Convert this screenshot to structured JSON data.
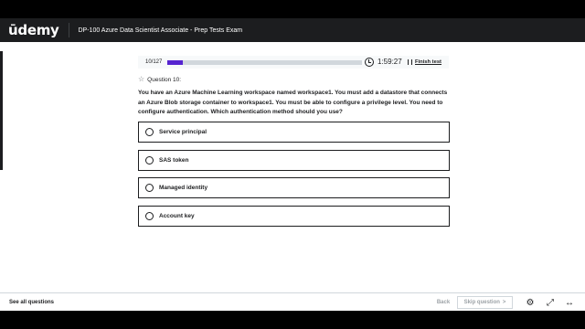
{
  "header": {
    "logo": "ūdemy",
    "course_title": "DP-100 Azure Data Scientist Associate - Prep Tests Exam"
  },
  "progress": {
    "counter": "10/127",
    "fraction": 0.0787,
    "timer": "1:59:27",
    "finish_label": "Finish test"
  },
  "question": {
    "label": "Question 10:",
    "text": "You have an Azure Machine Learning workspace named workspace1. You must add a datastore that connects an Azure Blob storage container to workspace1. You must be able to configure a privilege level. You need to configure authentication. Which authentication method should you use?",
    "options": [
      "Service principal",
      "SAS token",
      "Managed identity",
      "Account key"
    ]
  },
  "footer": {
    "see_all": "See all questions",
    "back": "Back",
    "skip": "Skip question",
    "skip_chevron": ">"
  },
  "icons": {
    "star": "☆",
    "settings": "⚙",
    "fullscreen": "⤢",
    "expand": "↔"
  },
  "colors": {
    "header_bg": "#1c1d1f",
    "progress_fill": "#5624d0",
    "progress_track": "#d1d7dc",
    "disabled_text": "#9da3a7"
  }
}
